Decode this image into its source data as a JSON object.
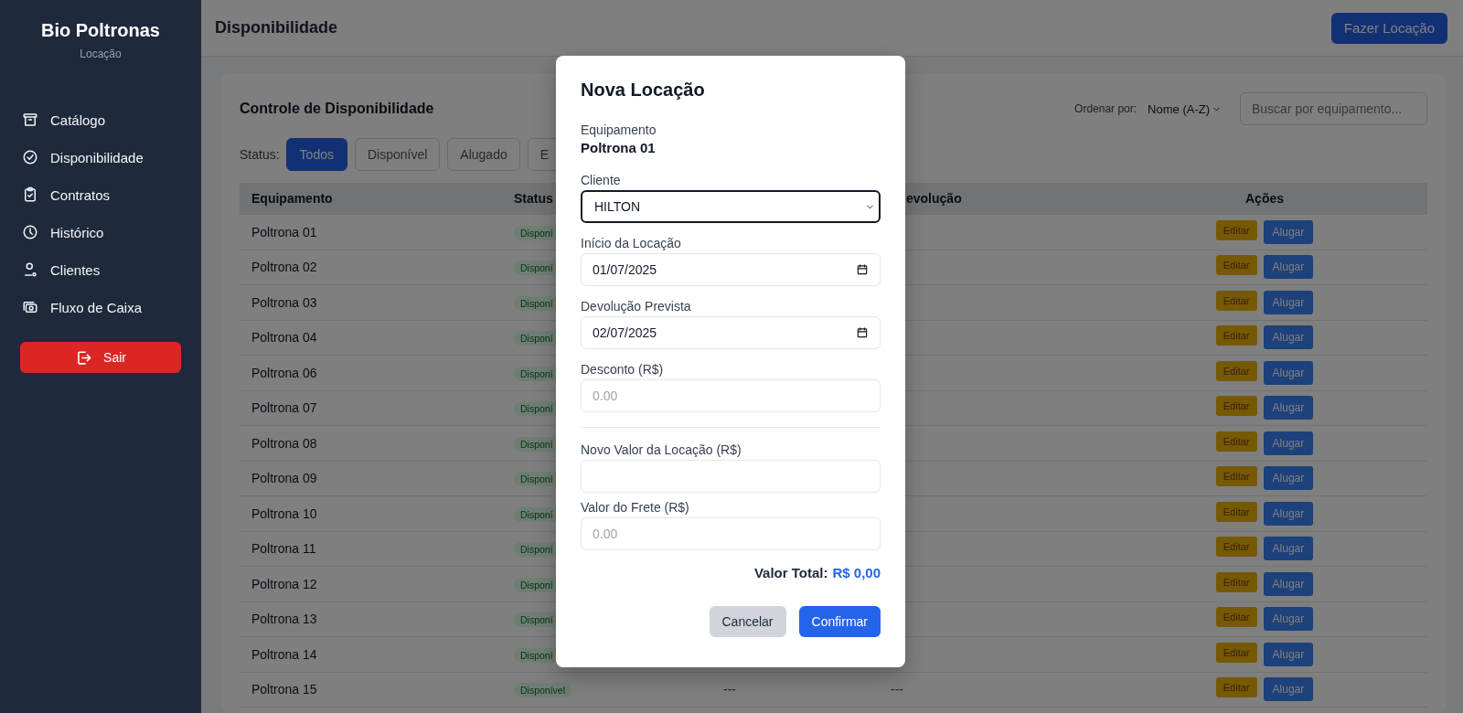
{
  "sidebar": {
    "brand": "Bio Poltronas",
    "subtitle": "Locação",
    "items": [
      {
        "label": "Catálogo",
        "selected": false
      },
      {
        "label": "Disponibilidade",
        "selected": false
      },
      {
        "label": "Contratos",
        "selected": false
      },
      {
        "label": "Histórico",
        "selected": false
      },
      {
        "label": "Clientes",
        "selected": false
      },
      {
        "label": "Fluxo de Caixa",
        "selected": false
      }
    ],
    "logout": "Sair"
  },
  "header": {
    "title": "Disponibilidade",
    "action": "Fazer Locação"
  },
  "card": {
    "title": "Controle de Disponibilidade",
    "sort_label": "Ordenar por:",
    "sort_value": "Nome (A-Z)",
    "search_placeholder": "Buscar por equipamento...",
    "status_label": "Status:",
    "filters": [
      {
        "label": "Todos",
        "selected": true
      },
      {
        "label": "Disponível",
        "selected": false
      },
      {
        "label": "Alugado",
        "selected": false
      },
      {
        "label": "E",
        "selected": false
      }
    ],
    "table": {
      "columns": [
        "Equipamento",
        "Status",
        "evolução",
        "Ações"
      ],
      "rows": [
        {
          "equipment": "Poltrona 01",
          "status": "Disponí",
          "actions": [
            "Editar",
            "Alugar"
          ]
        },
        {
          "equipment": "Poltrona 02",
          "status": "Disponí",
          "actions": [
            "Editar",
            "Alugar"
          ]
        },
        {
          "equipment": "Poltrona 03",
          "status": "Disponí",
          "actions": [
            "Editar",
            "Alugar"
          ]
        },
        {
          "equipment": "Poltrona 04",
          "status": "Disponí",
          "actions": [
            "Editar",
            "Alugar"
          ]
        },
        {
          "equipment": "Poltrona 06",
          "status": "Disponí",
          "actions": [
            "Editar",
            "Alugar"
          ]
        },
        {
          "equipment": "Poltrona 07",
          "status": "Disponí",
          "actions": [
            "Editar",
            "Alugar"
          ]
        },
        {
          "equipment": "Poltrona 08",
          "status": "Disponí",
          "actions": [
            "Editar",
            "Alugar"
          ]
        },
        {
          "equipment": "Poltrona 09",
          "status": "Disponí",
          "actions": [
            "Editar",
            "Alugar"
          ]
        },
        {
          "equipment": "Poltrona 10",
          "status": "Disponí",
          "actions": [
            "Editar",
            "Alugar"
          ]
        },
        {
          "equipment": "Poltrona 11",
          "status": "Disponí",
          "actions": [
            "Editar",
            "Alugar"
          ]
        },
        {
          "equipment": "Poltrona 12",
          "status": "Disponí",
          "actions": [
            "Editar",
            "Alugar"
          ]
        },
        {
          "equipment": "Poltrona 13",
          "status": "Disponí",
          "actions": [
            "Editar",
            "Alugar"
          ]
        },
        {
          "equipment": "Poltrona 14",
          "status": "Disponí",
          "actions": [
            "Editar",
            "Alugar"
          ]
        },
        {
          "equipment": "Poltrona 15",
          "status": "Disponível",
          "column_3": "---",
          "column_4": "---",
          "actions": [
            "Editar",
            "Alugar"
          ]
        }
      ]
    }
  },
  "modal": {
    "title": "Nova Locação",
    "equipment_label": "Equipamento",
    "equipment": "Poltrona 01",
    "fields": [
      {
        "kind": "select",
        "label": "Cliente",
        "value": "HILTON",
        "focused": true
      },
      {
        "kind": "date",
        "label": "Início da Locação",
        "value": "01/07/2025",
        "focused": false
      },
      {
        "kind": "date",
        "label": "Devolução Prevista",
        "value": "02/07/2025",
        "focused": false
      },
      {
        "kind": "text",
        "label": "Desconto (R$)",
        "placeholder": "0.00",
        "focused": false
      },
      {
        "kind": "divider"
      },
      {
        "kind": "text",
        "label": "Novo Valor da Locação (R$)",
        "focused": false
      },
      {
        "kind": "text",
        "label": "Valor do Frete (R$)",
        "placeholder": "0.00",
        "focused": false
      }
    ],
    "total_label": "Valor Total:",
    "total_value": "R$ 0,00",
    "buttons": [
      {
        "label": "Cancelar",
        "kind": "secondary"
      },
      {
        "label": "Confirmar",
        "kind": "primary"
      }
    ]
  }
}
